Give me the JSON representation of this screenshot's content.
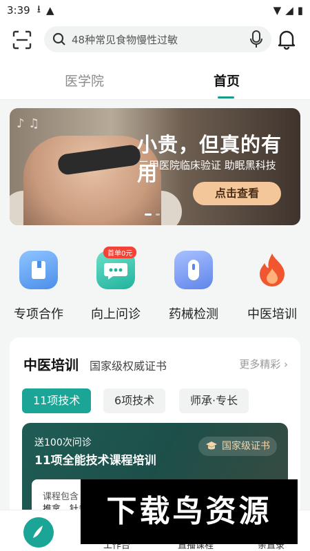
{
  "status_bar": {
    "time": "3:39"
  },
  "search": {
    "placeholder": "48种常见食物慢性过敏"
  },
  "tabs": [
    {
      "label": "医学院"
    },
    {
      "label": "首页"
    }
  ],
  "banner": {
    "headline": "小贵，但真的有用",
    "subtitle": "三甲医院临床验证 助眠黑科技",
    "cta": "点击查看"
  },
  "quick_actions": [
    {
      "label": "专项合作",
      "icon": "book-icon",
      "color": "#5aa2f0"
    },
    {
      "label": "向上问诊",
      "icon": "chat-icon",
      "color": "#36c7b0",
      "badge": "首单0元"
    },
    {
      "label": "药械检测",
      "icon": "capsule-icon",
      "color": "#6f95ef"
    },
    {
      "label": "中医培训",
      "icon": "flame-icon",
      "color": "#f0572e"
    }
  ],
  "section": {
    "title": "中医培训",
    "subtitle": "国家级权威证书",
    "more": "更多精彩",
    "chips": [
      "11项技术",
      "6项技术",
      "师承·专长"
    ]
  },
  "course": {
    "line1": "送100次问诊",
    "line2": "11项全能技术课程培训",
    "badge": "国家级证书",
    "inner_line1": "课程包含",
    "inner_line2": "推拿、针灸..."
  },
  "bottom_nav": [
    "工作台",
    "直播课程",
    "亲直录"
  ],
  "watermark": "下载鸟资源"
}
